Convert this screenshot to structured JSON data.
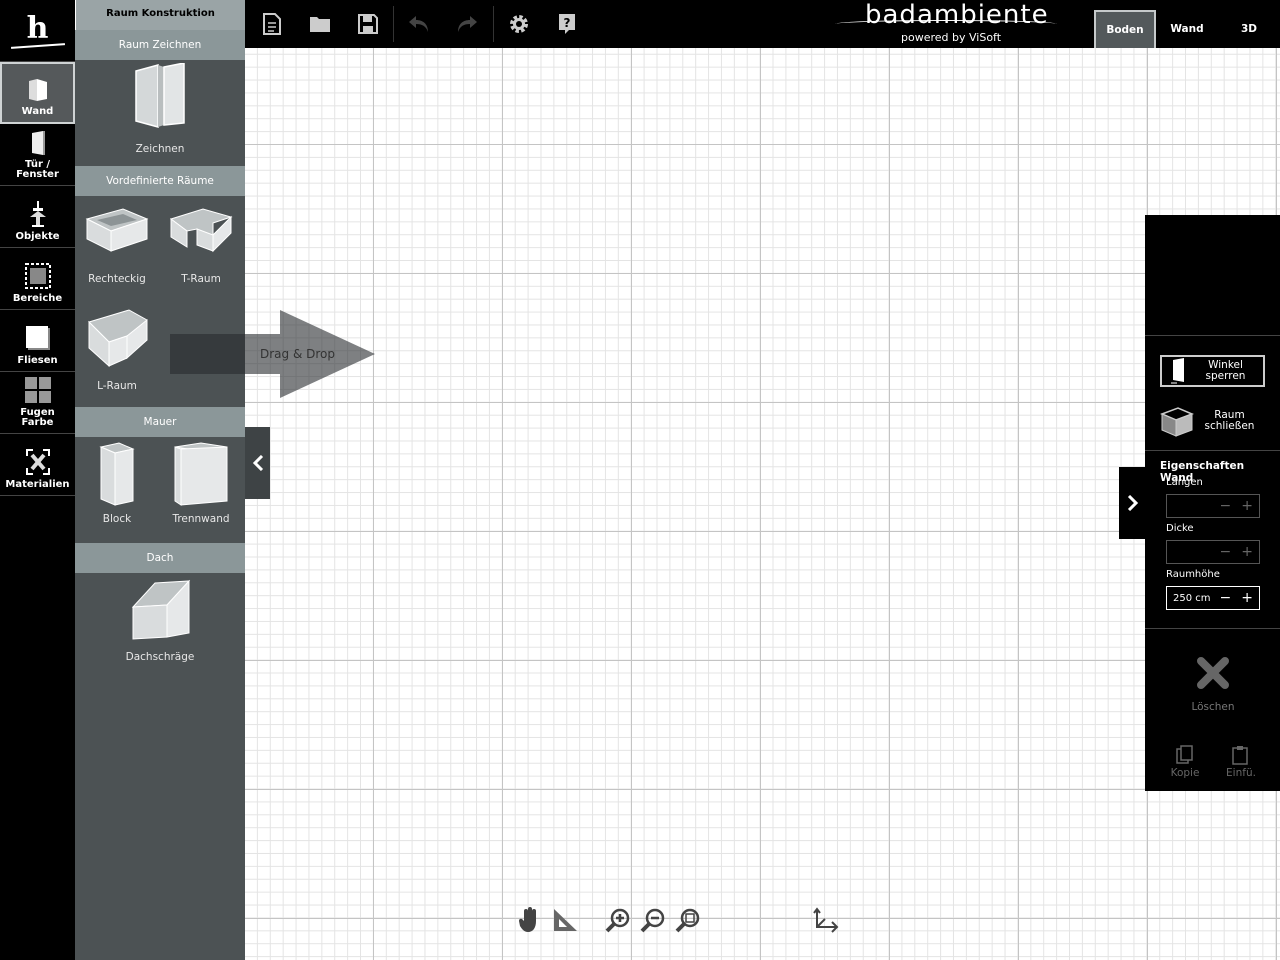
{
  "rail": {
    "items": [
      {
        "label": "Wand",
        "icon": "wall-icon",
        "active": true
      },
      {
        "label": "Tür /\nFenster",
        "icon": "door-icon"
      },
      {
        "label": "Objekte",
        "icon": "faucet-icon"
      },
      {
        "label": "Bereiche",
        "icon": "area-icon"
      },
      {
        "label": "Fliesen",
        "icon": "tile-icon"
      },
      {
        "label": "Fugen\nFarbe",
        "icon": "grout-color-icon"
      },
      {
        "label": "Materialien",
        "icon": "materials-icon"
      }
    ]
  },
  "panel": {
    "title": "Raum Konstruktion",
    "sections": {
      "draw": "Raum Zeichnen",
      "predefined": "Vordefinierte Räume",
      "wall": "Mauer",
      "roof": "Dach"
    },
    "items": {
      "zeichnen": "Zeichnen",
      "rechteckig": "Rechteckig",
      "t_raum": "T-Raum",
      "l_raum": "L-Raum",
      "block": "Block",
      "trennwand": "Trennwand",
      "dachschraege": "Dachschräge"
    }
  },
  "drag_hint": "Drag & Drop",
  "brand": {
    "name": "badambiente",
    "sub": "powered by ViSoft"
  },
  "view_tabs": [
    {
      "label": "Boden",
      "active": true
    },
    {
      "label": "Wand"
    },
    {
      "label": "3D"
    }
  ],
  "right_panel": {
    "lock_angle": "Winkel\nsperren",
    "close_room": "Raum\nschließen",
    "properties_title": "Eigenschaften Wand",
    "length_label": "Längen",
    "length_value": "",
    "thickness_label": "Dicke",
    "thickness_value": "",
    "room_height_label": "Raumhöhe",
    "room_height_value": "250 cm",
    "delete": "Löschen",
    "copy": "Kopie",
    "paste": "Einfü."
  },
  "colors": {
    "rail_bg": "#000000",
    "panel_bg": "#4c5254",
    "section_bg": "#8b9799",
    "active_border": "#cfd3d4"
  }
}
